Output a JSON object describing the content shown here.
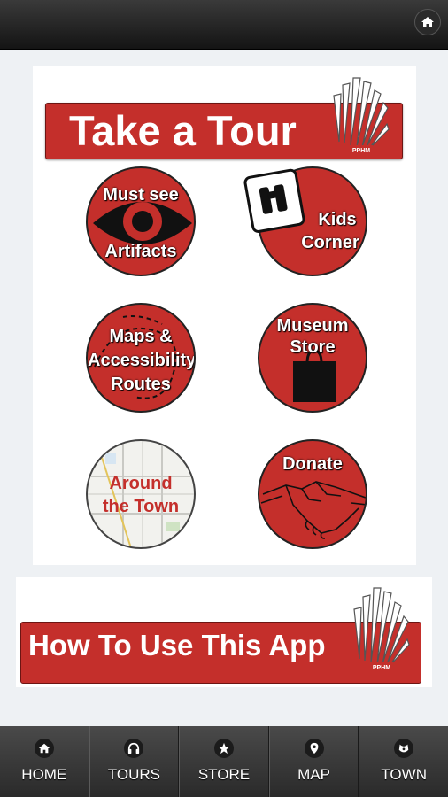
{
  "header": {
    "home_icon": "home-icon"
  },
  "tour": {
    "title": "Take a Tour",
    "logo_text": "PPHM",
    "tiles": [
      {
        "label_line1": "Must see",
        "label_line2": "Artifacts",
        "icon": "eye-icon"
      },
      {
        "label_line1": "Kids",
        "label_line2": "Corner",
        "icon": "binoculars-icon"
      },
      {
        "label_line1": "Maps &",
        "label_line2": "Accessibility",
        "label_line3": "Routes",
        "icon": "route-icon"
      },
      {
        "label_line1": "Museum",
        "label_line2": "Store",
        "icon": "shopping-bag-icon"
      },
      {
        "label_line1": "Around",
        "label_line2": "the Town",
        "icon": "map-icon"
      },
      {
        "label_line1": "Donate",
        "icon": "handshake-icon"
      }
    ]
  },
  "how_to": {
    "title": "How To Use This App",
    "logo_text": "PPHM"
  },
  "tabs": [
    {
      "label": "HOME",
      "icon": "home-icon"
    },
    {
      "label": "TOURS",
      "icon": "headphones-icon"
    },
    {
      "label": "STORE",
      "icon": "star-icon"
    },
    {
      "label": "MAP",
      "icon": "map-pin-icon"
    },
    {
      "label": "TOWN",
      "icon": "town-icon"
    }
  ],
  "colors": {
    "accent": "#c42f2b",
    "bar": "#2a2a2a",
    "text": "#ffffff"
  }
}
